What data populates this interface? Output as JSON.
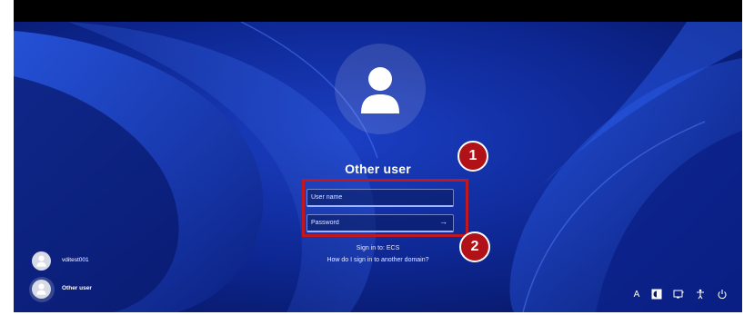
{
  "login": {
    "username_heading": "Other user",
    "username_placeholder": "User name",
    "password_placeholder": "Password",
    "submit_icon": "arrow-right-icon",
    "sign_in_to": "Sign in to: ECS",
    "other_domain_link": "How do I sign in to another domain?"
  },
  "annotations": {
    "callout_1": "1",
    "callout_2": "2",
    "highlight_color": "#c0181e"
  },
  "user_list": [
    {
      "name": "vditest001",
      "icon": "user-avatar-icon"
    },
    {
      "name": "Other user",
      "icon": "user-avatar-icon",
      "selected": true
    }
  ],
  "tray": {
    "language_label": "A",
    "icons": [
      "language-icon",
      "accessibility-contrast-icon",
      "display-icon",
      "accessibility-icon",
      "power-icon"
    ]
  },
  "colors": {
    "wallpaper": "#0a1b6e",
    "accent": "#9fb4ff",
    "callout": "#b01218"
  }
}
